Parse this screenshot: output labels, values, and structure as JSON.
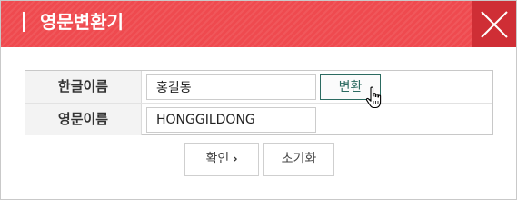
{
  "dialog": {
    "title": "영문변환기",
    "close_icon": "close-icon"
  },
  "form": {
    "korean_name_label": "한글이름",
    "korean_name_value": "홍길동",
    "convert_button_label": "변환",
    "english_name_label": "영문이름",
    "english_name_value": "HONGGILDONG"
  },
  "actions": {
    "confirm_label": "확인",
    "confirm_icon": "chevron-right-icon",
    "reset_label": "초기화"
  },
  "colors": {
    "title_bar": "#ef4a4f",
    "close_button": "#cf2e35",
    "convert_button_border": "#2c6b61"
  }
}
